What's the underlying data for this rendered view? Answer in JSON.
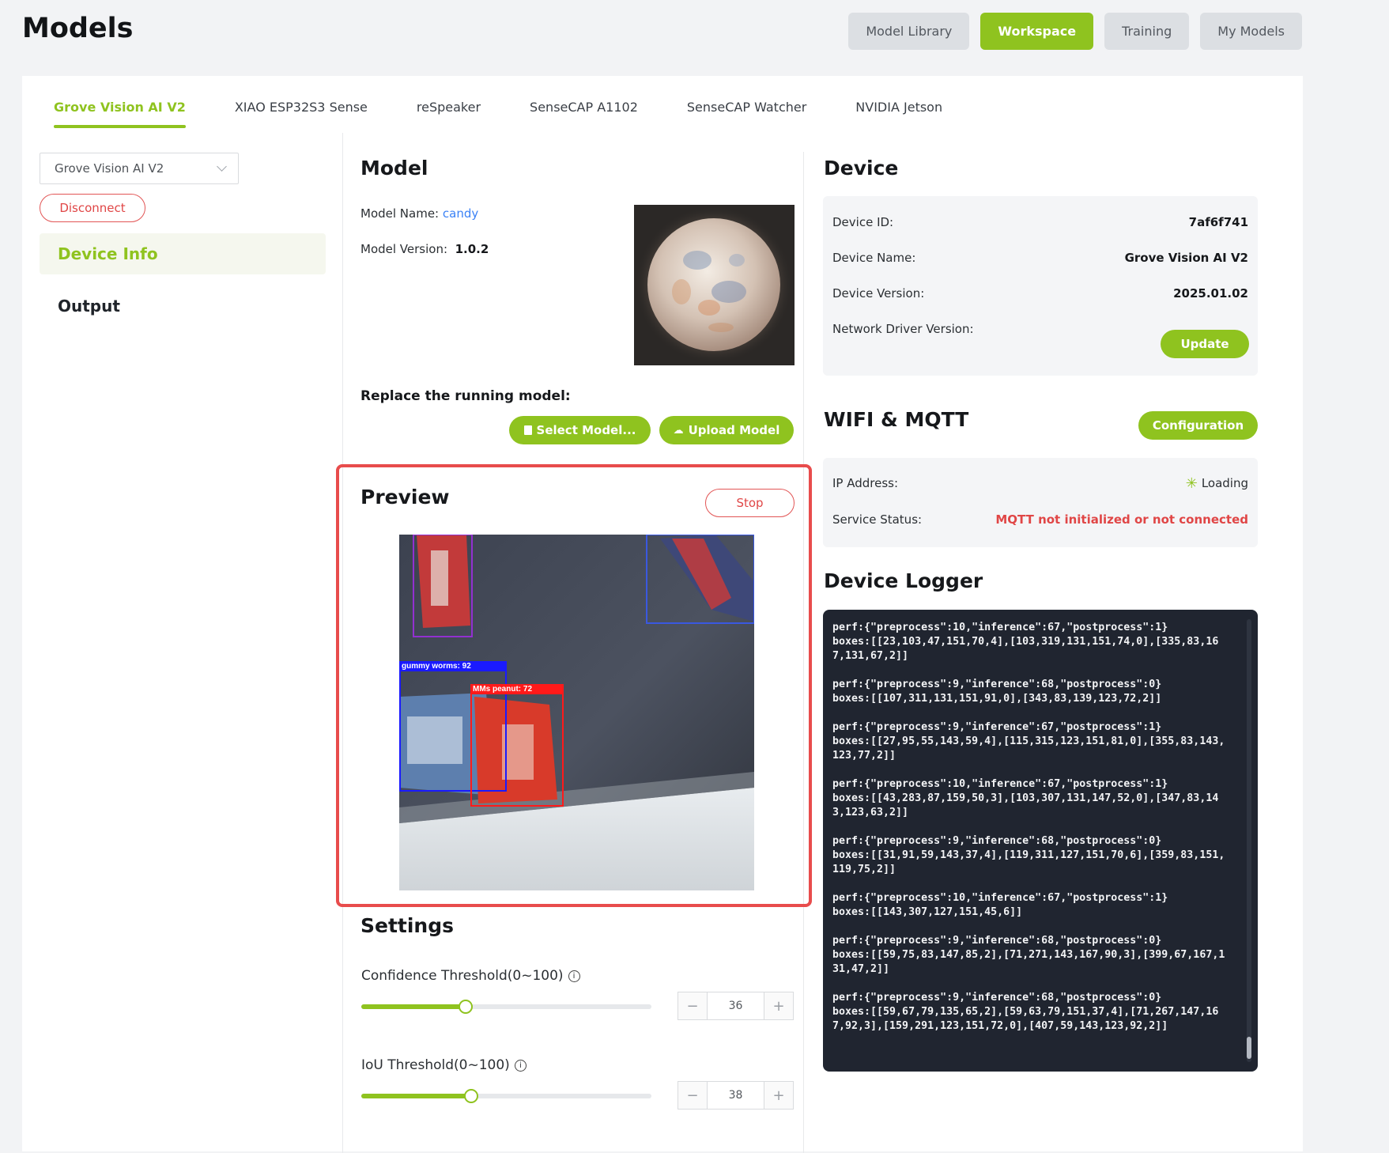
{
  "page": {
    "title": "Models"
  },
  "top_tabs": [
    {
      "label": "Model Library",
      "active": false
    },
    {
      "label": "Workspace",
      "active": true
    },
    {
      "label": "Training",
      "active": false
    },
    {
      "label": "My Models",
      "active": false
    }
  ],
  "device_tabs": [
    {
      "label": "Grove Vision AI V2",
      "active": true
    },
    {
      "label": "XIAO ESP32S3 Sense",
      "active": false
    },
    {
      "label": "reSpeaker",
      "active": false
    },
    {
      "label": "SenseCAP A1102",
      "active": false
    },
    {
      "label": "SenseCAP Watcher",
      "active": false
    },
    {
      "label": "NVIDIA Jetson",
      "active": false
    }
  ],
  "sidebar": {
    "device_select": "Grove Vision AI V2",
    "disconnect_label": "Disconnect",
    "items": [
      {
        "label": "Device Info",
        "active": true
      },
      {
        "label": "Output",
        "active": false
      }
    ]
  },
  "model": {
    "heading": "Model",
    "name_label": "Model Name:",
    "name_value": "candy",
    "version_label": "Model Version:",
    "version_value": "1.0.2",
    "replace_label": "Replace the running model:",
    "select_button": "Select Model...",
    "upload_button": "Upload Model"
  },
  "preview": {
    "heading": "Preview",
    "stop_label": "Stop",
    "detections": [
      {
        "label": "gummy worms: 92",
        "color": "#1a1aff"
      },
      {
        "label": "MMs peanut: 72",
        "color": "#ff1a1a"
      }
    ]
  },
  "settings": {
    "heading": "Settings",
    "confidence": {
      "label": "Confidence Threshold(0~100)",
      "value": "36",
      "fraction": 0.36
    },
    "iou": {
      "label": "IoU Threshold(0~100)",
      "value": "38",
      "fraction": 0.38
    }
  },
  "device": {
    "heading": "Device",
    "rows": [
      {
        "label": "Device ID:",
        "value": "7af6f741"
      },
      {
        "label": "Device Name:",
        "value": "Grove Vision AI V2"
      },
      {
        "label": "Device Version:",
        "value": "2025.01.02"
      }
    ],
    "driver_label": "Network Driver Version:",
    "update_label": "Update"
  },
  "wifi": {
    "heading": "WIFI & MQTT",
    "config_label": "Configuration",
    "ip_label": "IP Address:",
    "ip_value": "Loading",
    "status_label": "Service Status:",
    "status_value": "MQTT not initialized or not connected",
    "status_color": "#e04646"
  },
  "logger": {
    "heading": "Device Logger",
    "entries": [
      "perf:{\"preprocess\":10,\"inference\":67,\"postprocess\":1}\nboxes:[[23,103,47,151,70,4],[103,319,131,151,74,0],[335,83,167,131,67,2]]",
      "perf:{\"preprocess\":9,\"inference\":68,\"postprocess\":0}\nboxes:[[107,311,131,151,91,0],[343,83,139,123,72,2]]",
      "perf:{\"preprocess\":9,\"inference\":67,\"postprocess\":1}\nboxes:[[27,95,55,143,59,4],[115,315,123,151,81,0],[355,83,143,123,77,2]]",
      "perf:{\"preprocess\":10,\"inference\":67,\"postprocess\":1}\nboxes:[[43,283,87,159,50,3],[103,307,131,147,52,0],[347,83,143,123,63,2]]",
      "perf:{\"preprocess\":9,\"inference\":68,\"postprocess\":0}\nboxes:[[31,91,59,143,37,4],[119,311,127,151,70,6],[359,83,151,119,75,2]]",
      "perf:{\"preprocess\":10,\"inference\":67,\"postprocess\":1}\nboxes:[[143,307,127,151,45,6]]",
      "perf:{\"preprocess\":9,\"inference\":68,\"postprocess\":0}\nboxes:[[59,75,83,147,85,2],[71,271,143,167,90,3],[399,67,167,131,47,2]]",
      "perf:{\"preprocess\":9,\"inference\":68,\"postprocess\":0}\nboxes:[[59,67,79,135,65,2],[59,63,79,151,37,4],[71,267,147,167,92,3],[159,291,123,151,72,0],[407,59,143,123,92,2]]"
    ]
  },
  "colors": {
    "accent": "#8fc31f",
    "danger": "#e04646",
    "logger_bg": "#202530"
  }
}
